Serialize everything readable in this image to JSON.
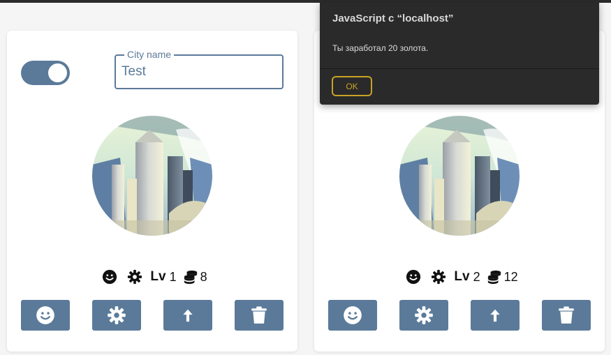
{
  "colors": {
    "accent": "#5b7a99",
    "dialog_bg": "#2a2a2a",
    "dialog_button": "#c9a227"
  },
  "cards": [
    {
      "toggle_on": true,
      "city_name_label": "City name",
      "city_name_value": "Test",
      "stats": {
        "lv_label": "Lv",
        "level": "1",
        "gold": "8"
      },
      "buttons": [
        "smile-icon",
        "gear-icon",
        "arrow-up-icon",
        "trash-icon"
      ]
    },
    {
      "stats": {
        "lv_label": "Lv",
        "level": "2",
        "gold": "12"
      },
      "buttons": [
        "smile-icon",
        "gear-icon",
        "arrow-up-icon",
        "trash-icon"
      ]
    }
  ],
  "dialog": {
    "title": "JavaScript с “localhost”",
    "message": "Ты заработал 20 золота.",
    "ok_label": "OK"
  }
}
